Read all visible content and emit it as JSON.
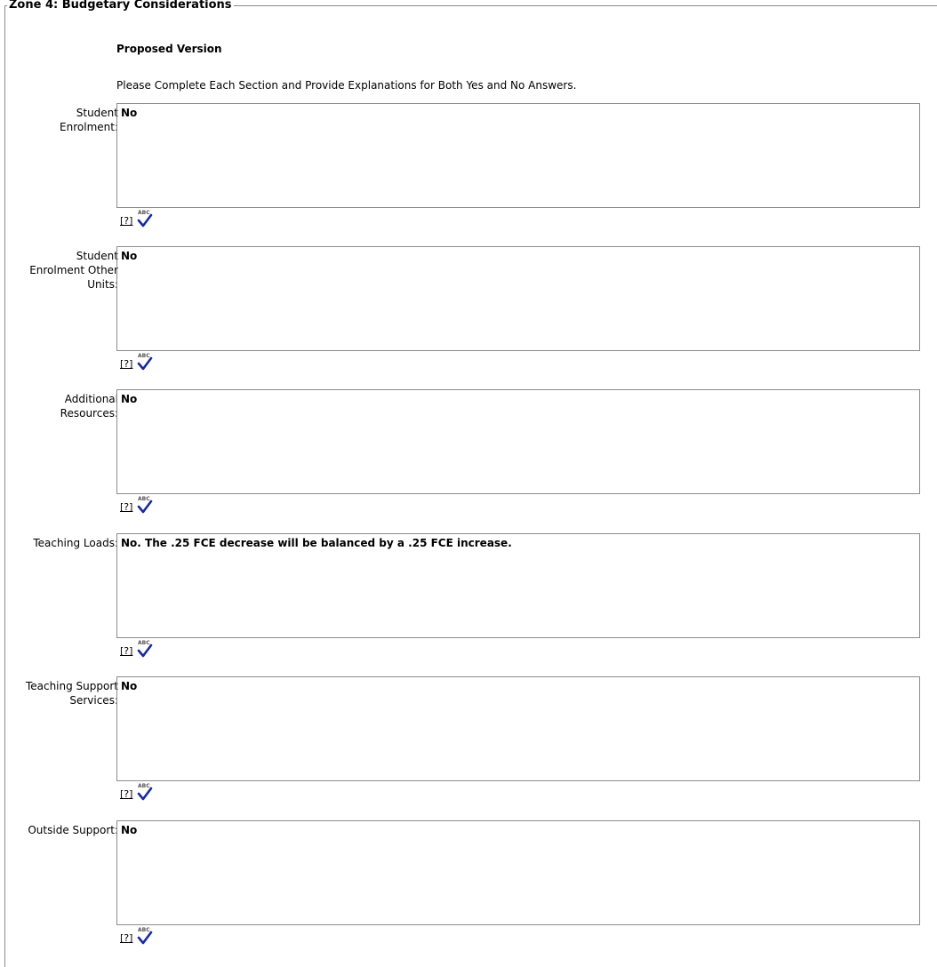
{
  "zone": {
    "title": "Zone 4: Budgetary Considerations",
    "subtitle": "Proposed Version",
    "instructions": "Please Complete Each Section and Provide Explanations for Both Yes and No Answers."
  },
  "fields": [
    {
      "label": "Student Enrolment:",
      "value": "No",
      "help": "[?]",
      "spellcheck_icon": "abc-spellcheck-icon"
    },
    {
      "label": "Student Enrolment Other Units:",
      "value": "No",
      "help": "[?]",
      "spellcheck_icon": "abc-spellcheck-icon"
    },
    {
      "label": "Additional Resources:",
      "value": "No",
      "help": "[?]",
      "spellcheck_icon": "abc-spellcheck-icon"
    },
    {
      "label": "Teaching Loads:",
      "value": "No. The .25 FCE decrease will be balanced by a .25 FCE increase.",
      "help": "[?]",
      "spellcheck_icon": "abc-spellcheck-icon"
    },
    {
      "label": "Teaching Support Services:",
      "value": "No",
      "help": "[?]",
      "spellcheck_icon": "abc-spellcheck-icon"
    },
    {
      "label": "Outside Support:",
      "value": "No",
      "help": "[?]",
      "spellcheck_icon": "abc-spellcheck-icon"
    }
  ],
  "colors": {
    "border": "#8c8c8c",
    "checkmark": "#1a2a9c",
    "text": "#000000"
  }
}
